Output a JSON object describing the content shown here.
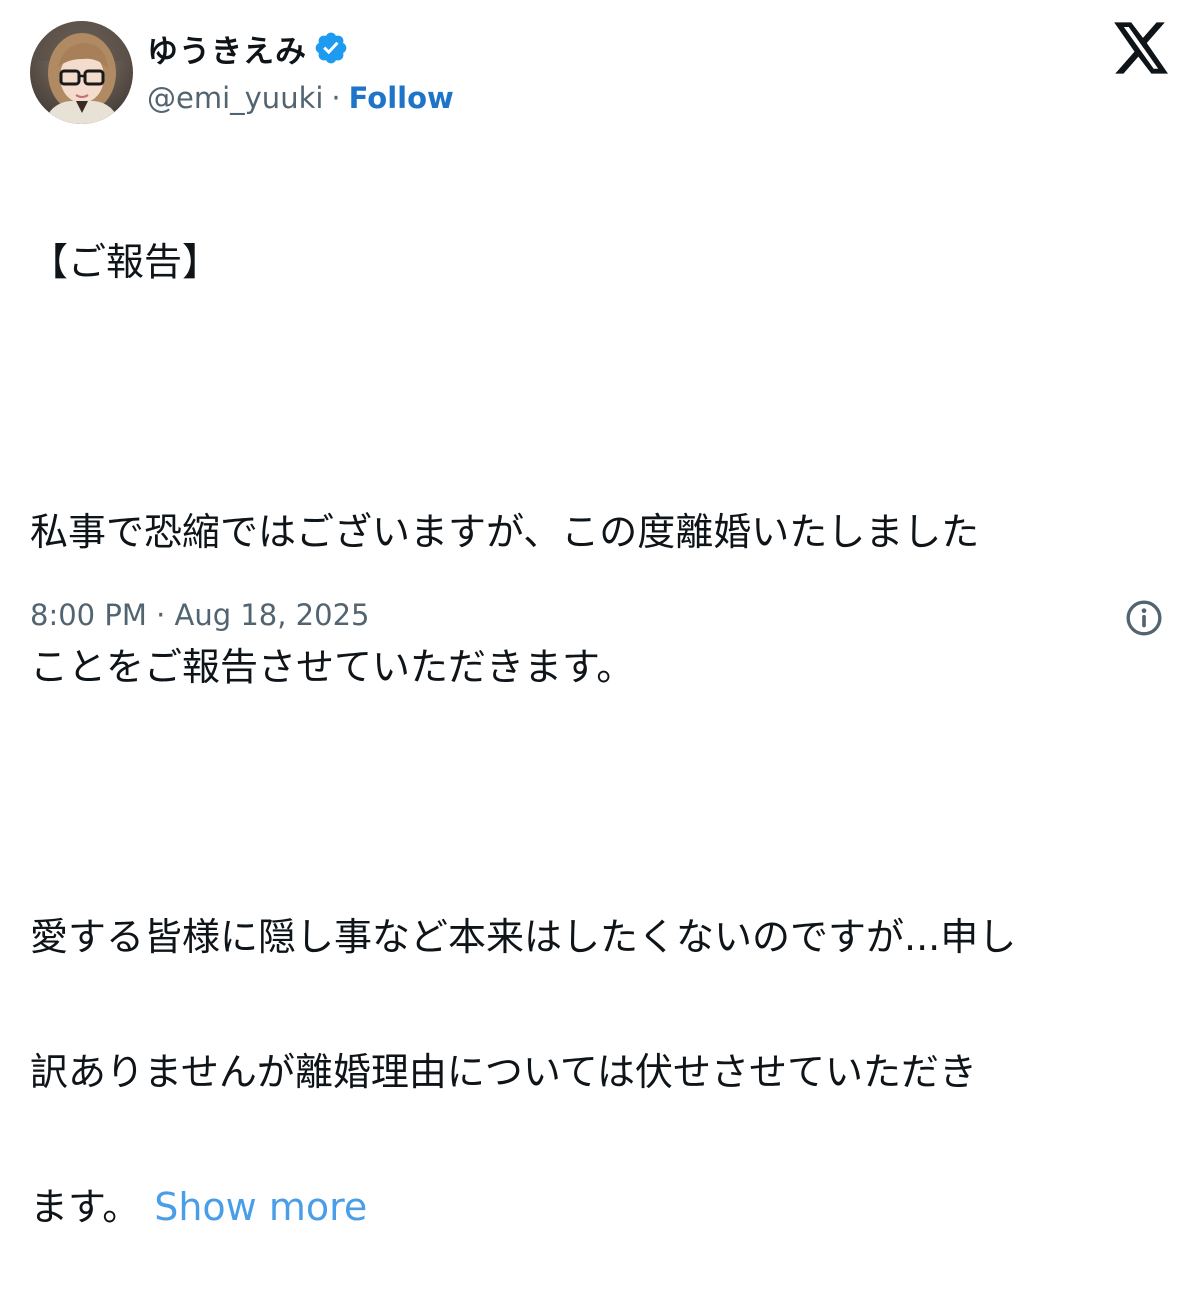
{
  "author": {
    "display_name": "ゆうきえみ",
    "handle": "@emi_yuuki",
    "separator": "·",
    "follow_label": "Follow",
    "verified_icon": "verified-badge-icon",
    "verified_color": "#1d9bf0"
  },
  "platform": {
    "logo_icon": "x-logo-icon"
  },
  "tweet": {
    "lines": [
      "【ご報告】",
      "",
      "私事で恐縮ではございますが、この度離婚いたしました",
      "ことをご報告させていただきます。",
      "",
      "愛する皆様に隠し事など本来はしたくないのですが...申し",
      "訳ありませんが離婚理由については伏せさせていただき",
      "ます。"
    ],
    "show_more_label": "Show more",
    "link_color": "#4a9ee8"
  },
  "footer": {
    "timestamp": "8:00 PM · Aug 18, 2025",
    "info_icon": "info-icon"
  }
}
